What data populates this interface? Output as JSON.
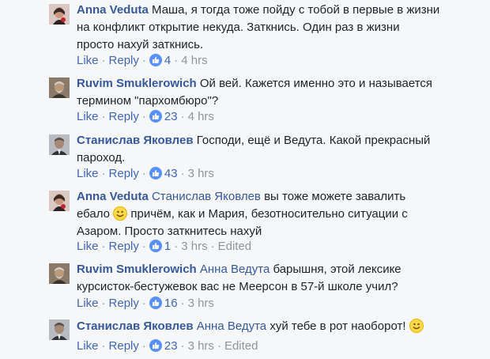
{
  "actions": {
    "like": "Like",
    "reply": "Reply",
    "edited": "Edited"
  },
  "comments": [
    {
      "author": "Anna Veduta",
      "mention": "",
      "text": "Маша, я тогда тоже пойду с тобой в первые в жизни на конфликт открытие некуда. Заткнись. Один раз в жизни просто нахуй заткнись.",
      "likes": "4",
      "time": "4 hrs",
      "edited": false
    },
    {
      "author": "Ruvim Smuklerowich",
      "mention": "",
      "text": "Ой вей. Кажется именно это и называется термином \"пархомбюро\"?",
      "likes": "23",
      "time": "4 hrs",
      "edited": false
    },
    {
      "author": "Станислав Яковлев",
      "mention": "",
      "text": "Господи, ещё и Ведута. Какой прекрасный пароход.",
      "likes": "43",
      "time": "3 hrs",
      "edited": false
    },
    {
      "author": "Anna Veduta",
      "mention": "Станислав Яковлев",
      "text_before_emoji": "вы тоже можете завалить ебало",
      "text_after_emoji": "причём, как и Мария, безотносительно ситуации с Азаром. Просто заткнитесь нахуй",
      "likes": "1",
      "time": "3 hrs",
      "edited": true
    },
    {
      "author": "Ruvim Smuklerowich",
      "mention": "Анна Ведута",
      "text": "барышня, этой лексике курсисток-бестужевок вас не Меерсон в 57-й школе учил?",
      "likes": "16",
      "time": "3 hrs",
      "edited": false
    },
    {
      "author": "Станислав Яковлев",
      "mention": "Анна Ведута",
      "text": "хуй тебе в рот наоборот!",
      "likes": "23",
      "time": "3 hrs",
      "edited": true
    }
  ]
}
